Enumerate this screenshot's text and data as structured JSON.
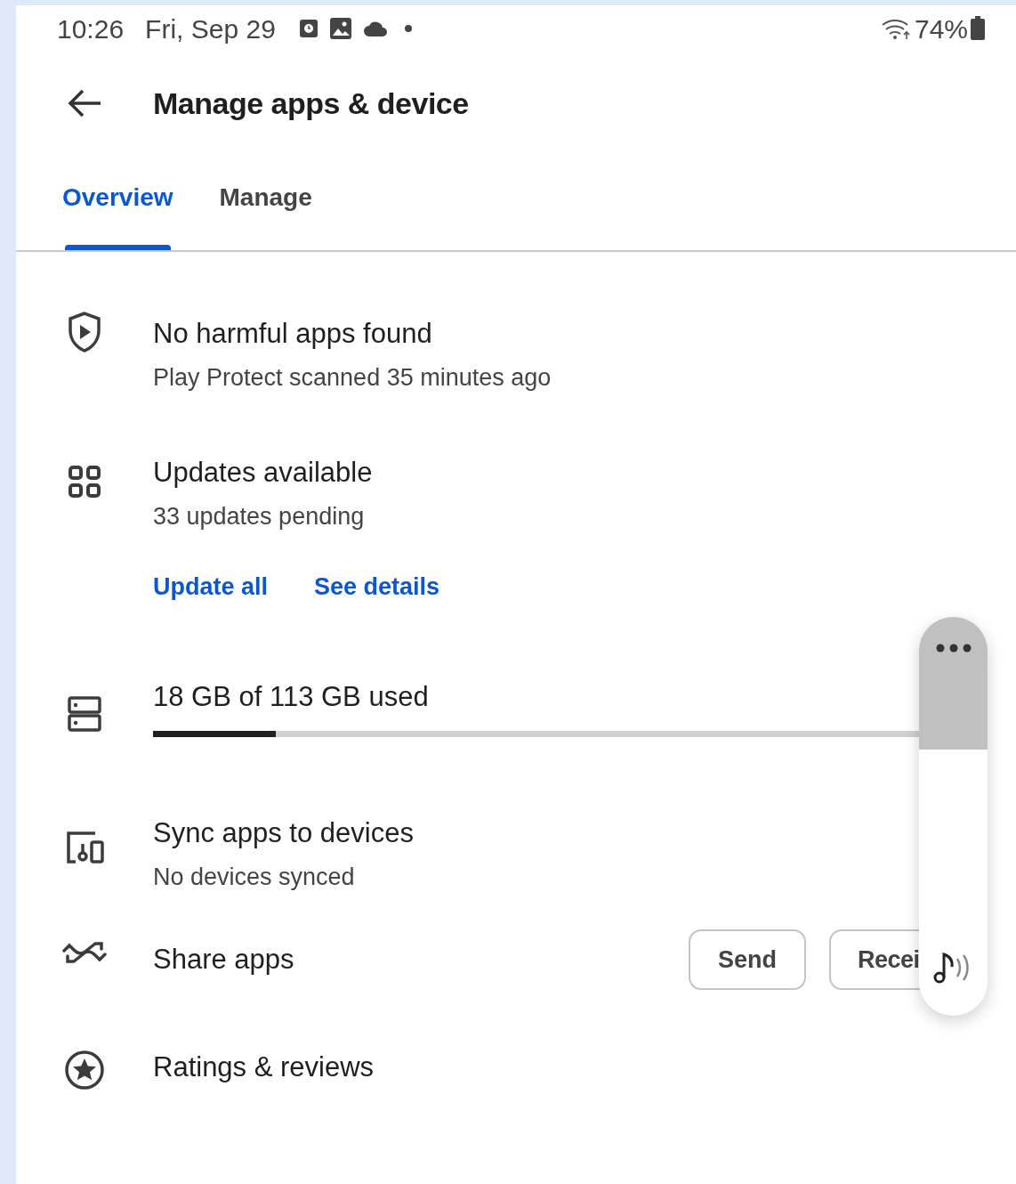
{
  "status_bar": {
    "time": "10:26",
    "date": "Fri, Sep 29",
    "battery": "74%"
  },
  "header": {
    "title": "Manage apps & device"
  },
  "tabs": [
    {
      "label": "Overview",
      "selected": true
    },
    {
      "label": "Manage",
      "selected": false
    }
  ],
  "protect": {
    "title": "No harmful apps found",
    "subtitle": "Play Protect scanned 35 minutes ago"
  },
  "updates": {
    "title": "Updates available",
    "subtitle": "33 updates pending",
    "actions": [
      "Update all",
      "See details"
    ]
  },
  "storage": {
    "title": "18 GB of 113 GB used",
    "level": 0.16
  },
  "sync": {
    "title": "Sync apps to devices",
    "subtitle": "No devices synced"
  },
  "share": {
    "title": "Share apps",
    "buttons": [
      "Send",
      "Recei"
    ]
  },
  "ratings": {
    "title": "Ratings & reviews"
  }
}
